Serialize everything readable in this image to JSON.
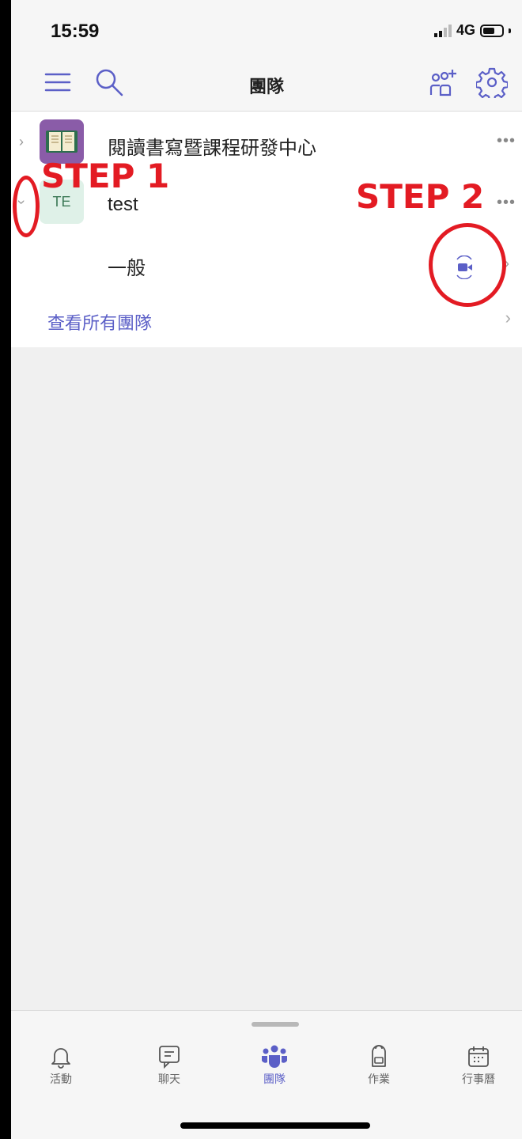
{
  "status_bar": {
    "time": "15:59",
    "network": "4G"
  },
  "header": {
    "title": "團隊",
    "icons": [
      "hamburger-menu-icon",
      "search-icon",
      "add-team-icon",
      "gear-icon"
    ]
  },
  "teams": [
    {
      "name": "閱讀書寫暨課程研發中心",
      "avatar_icon": "book-icon",
      "more": "•••"
    },
    {
      "name": "test",
      "avatar_text": "TE",
      "more": "•••"
    }
  ],
  "channel": {
    "name": "一般",
    "meet_icon": "video-camera-icon"
  },
  "see_all": {
    "label": "查看所有團隊"
  },
  "annotations": {
    "step1": "STEP 1",
    "step2": "STEP 2",
    "color": "#e31b23"
  },
  "bottom_nav": {
    "tabs": [
      {
        "label": "活動",
        "icon": "bell-icon"
      },
      {
        "label": "聊天",
        "icon": "chat-icon"
      },
      {
        "label": "團隊",
        "icon": "teams-icon",
        "active": true
      },
      {
        "label": "作業",
        "icon": "backpack-icon"
      },
      {
        "label": "行事曆",
        "icon": "calendar-icon"
      }
    ]
  },
  "colors": {
    "accent": "#5b5fc7",
    "annotation": "#e31b23"
  }
}
